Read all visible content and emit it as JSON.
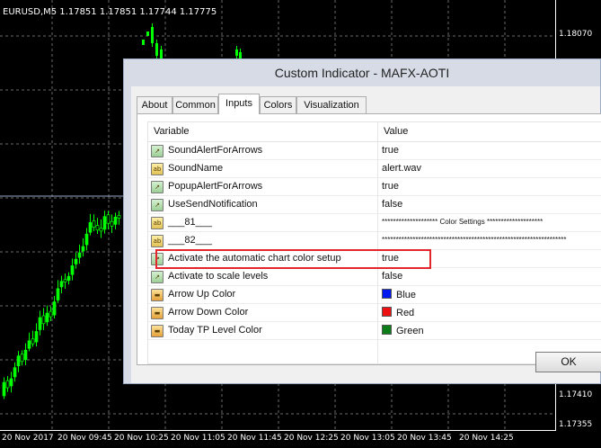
{
  "chart": {
    "title": "EURUSD,M5  1.17851 1.17851 1.17744 1.17775",
    "prices": [
      "1.18070",
      "1.17410",
      "1.17355"
    ],
    "times": [
      "20 Nov 2017",
      "20 Nov 09:45",
      "20 Nov 10:25",
      "20 Nov 11:05",
      "20 Nov 11:45",
      "20 Nov 12:25",
      "20 Nov 13:05",
      "20 Nov 13:45",
      "20 Nov 14:25"
    ],
    "bull_color": "#00ff00",
    "bear_color": "#000000"
  },
  "dialog": {
    "title": "Custom Indicator - MAFX-AOTI",
    "tabs": [
      "About",
      "Common",
      "Inputs",
      "Colors",
      "Visualization"
    ],
    "active_tab": "Inputs",
    "columns": {
      "variable": "Variable",
      "value": "Value"
    },
    "rows": [
      {
        "icon": "bool-param-icon",
        "name": "SoundAlertForArrows",
        "value": "true"
      },
      {
        "icon": "string-param-icon",
        "name": "SoundName",
        "value": "alert.wav"
      },
      {
        "icon": "bool-param-icon",
        "name": "PopupAlertForArrows",
        "value": "true"
      },
      {
        "icon": "bool-param-icon",
        "name": "UseSendNotification",
        "value": "false"
      },
      {
        "icon": "string-param-icon",
        "name": "___81___",
        "value": "******************** Color Settings ********************"
      },
      {
        "icon": "string-param-icon",
        "name": "___82___",
        "value": "******************************************************************"
      },
      {
        "icon": "bool-param-icon",
        "name": "Activate the automatic chart color setup",
        "value": "true"
      },
      {
        "icon": "bool-param-icon",
        "name": "Activate to scale levels",
        "value": "false"
      },
      {
        "icon": "color-param-icon",
        "name": "Arrow Up Color",
        "value": "Blue",
        "swatch": "#0018f0"
      },
      {
        "icon": "color-param-icon",
        "name": "Arrow Down Color",
        "value": "Red",
        "swatch": "#ee1111"
      },
      {
        "icon": "color-param-icon",
        "name": "Today TP Level Color",
        "value": "Green",
        "swatch": "#0d7d1a"
      }
    ],
    "ok_label": "OK",
    "highlight_color": "#e2262b"
  }
}
